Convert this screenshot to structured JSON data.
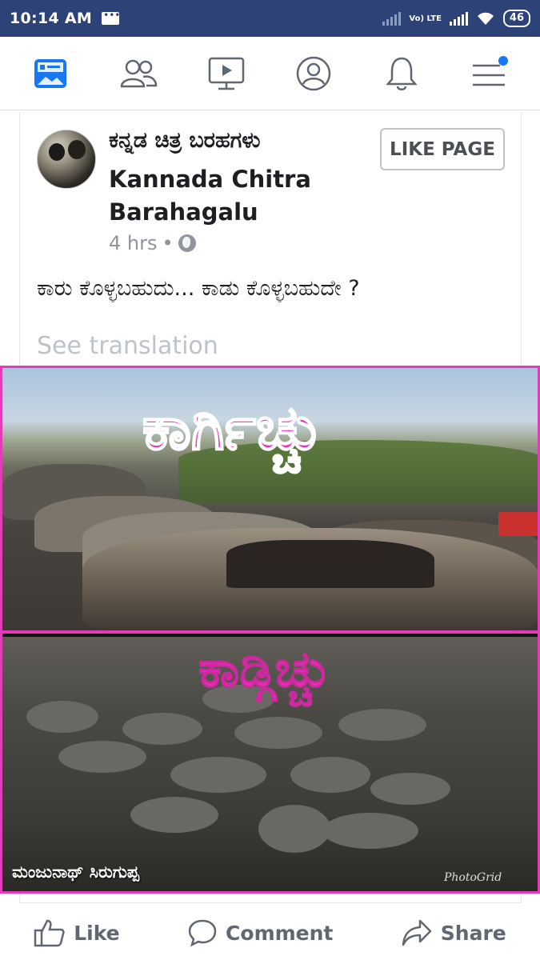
{
  "status_bar": {
    "time": "10:14 AM",
    "network": "Vo) LTE",
    "battery": "46"
  },
  "nav": {
    "icons": [
      "news-feed-icon",
      "friends-icon",
      "watch-icon",
      "profile-icon",
      "notifications-icon",
      "menu-icon"
    ],
    "accent": "#1877f2"
  },
  "post": {
    "page_name_kannada": "ಕನ್ನಡ ಚಿತ್ರ ಬರಹಗಳು",
    "page_name_english": "Kannada Chitra Barahagalu",
    "like_page_label": "LIKE PAGE",
    "time_ago": "4 hrs",
    "separator": "•",
    "text": "ಕಾರು ಕೊಳ್ಳಬಹುದು... ಕಾಡು ಕೊಳ್ಳಬಹುದೇ ?",
    "see_translation": "See translation"
  },
  "photo": {
    "overlay_top": "ಕಾರ್ಗಿಚ್ಚು",
    "overlay_bottom": "ಕಾಡ್ಗಿಚ್ಚು",
    "credit": "ಮಂಜುನಾಥ್ ಸಿರುಗುಪ್ಪ",
    "watermark": "PhotoGrid",
    "border_color": "#e43cb8"
  },
  "actions": {
    "like": "Like",
    "comment": "Comment",
    "share": "Share"
  }
}
